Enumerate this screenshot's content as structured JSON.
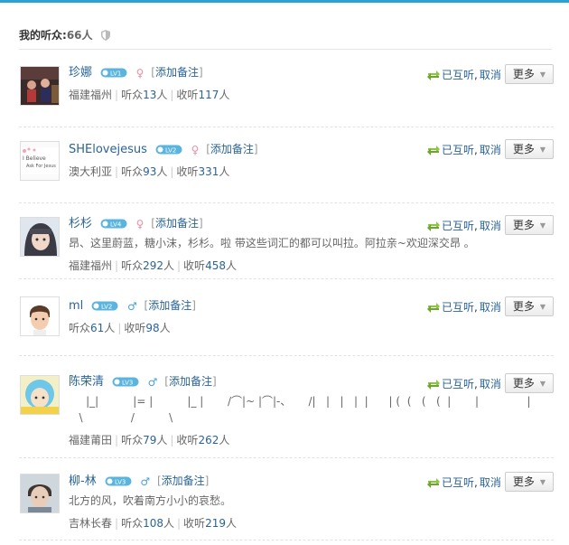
{
  "header": {
    "title": "我的听众:",
    "count": "66人"
  },
  "labels": {
    "listeners": "听众",
    "following": "收听",
    "unit": "人",
    "add_note": "添加备注",
    "mutual": "已互听",
    "cancel": "取消",
    "more": "更多"
  },
  "colors": {
    "accent": "#2ba1d6",
    "link": "#2a6496",
    "arrow": "#8cc63f"
  },
  "users": [
    {
      "name": "珍娜",
      "level": "LV1",
      "gender": "female",
      "signature": "",
      "location": "福建福州",
      "listeners": "13",
      "following": "117"
    },
    {
      "name": "SHElovejesus",
      "level": "LV2",
      "gender": "female",
      "signature": "",
      "location": "澳大利亚",
      "listeners": "93",
      "following": "331"
    },
    {
      "name": "杉杉",
      "level": "LV4",
      "gender": "female",
      "signature": "昂、这里蔚蓝，糖小沫，杉杉。啦 带这些词汇的都可以叫拉。阿拉亲~欢迎深交昂 。",
      "location": "福建福州",
      "listeners": "292",
      "following": "458"
    },
    {
      "name": "ml",
      "level": "LV2",
      "gender": "male",
      "signature": "",
      "location": "",
      "listeners": "61",
      "following": "98"
    },
    {
      "name": "陈荣清",
      "level": "LV3",
      "gender": "male",
      "signature": "     |_|          |= |          |_ |       /⌒|~ |⌒|-、     /|   |   |   |  |      | (  (   (   (  |       |              |\n   \\              /          \\",
      "location": "福建莆田",
      "listeners": "79",
      "following": "262"
    },
    {
      "name": "柳-林",
      "level": "LV3",
      "gender": "male",
      "signature": "北方的风，吹着南方小小的哀愁。",
      "location": "吉林长春",
      "listeners": "108",
      "following": "219"
    }
  ]
}
